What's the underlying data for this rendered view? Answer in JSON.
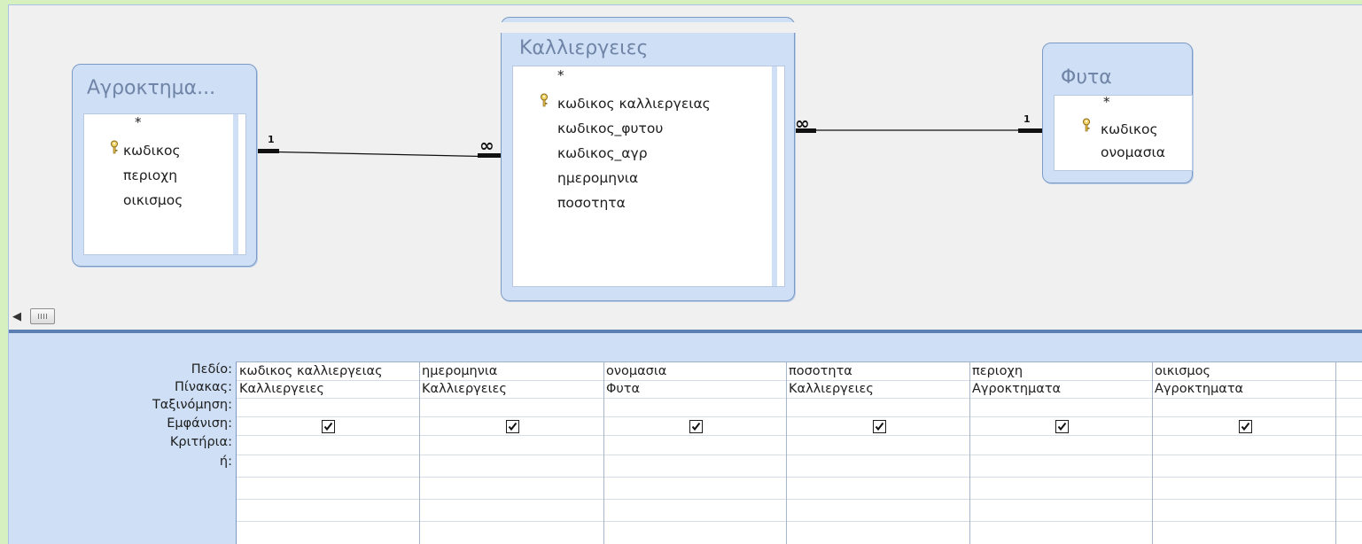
{
  "tables": {
    "agrokt": {
      "title": "Αγροκτημα...",
      "fields": [
        "*",
        "κωδικος",
        "περιοχη",
        "οικισμος"
      ],
      "key_field": "κωδικος"
    },
    "kall": {
      "title": "Καλλιεργειες",
      "fields": [
        "*",
        "κωδικος καλλιεργειας",
        "κωδικος_φυτου",
        "κωδικος_αγρ",
        "ημερομηνια",
        "ποσοτητα"
      ],
      "key_field": "κωδικος καλλιεργειας"
    },
    "fyta": {
      "title": "Φυτα",
      "fields": [
        "*",
        "κωδικος",
        "ονομασια"
      ],
      "key_field": "κωδικος"
    }
  },
  "relationships": [
    {
      "from": "Αγροκτημα...",
      "to": "Καλλιεργειες",
      "from_label": "1",
      "to_label": "∞"
    },
    {
      "from": "Καλλιεργειες",
      "to": "Φυτα",
      "from_label": "∞",
      "to_label": "1"
    }
  ],
  "grid": {
    "row_labels": [
      "Πεδίο:",
      "Πίνακας:",
      "Ταξινόμηση:",
      "Εμφάνιση:",
      "Κριτήρια:",
      "ή:"
    ],
    "columns": [
      {
        "field": "κωδικος καλλιεργειας",
        "table": "Καλλιεργειες",
        "sort": "",
        "show": true
      },
      {
        "field": "ημερομηνια",
        "table": "Καλλιεργειες",
        "sort": "",
        "show": true
      },
      {
        "field": "ονομασια",
        "table": "Φυτα",
        "sort": "",
        "show": true
      },
      {
        "field": "ποσοτητα",
        "table": "Καλλιεργειες",
        "sort": "",
        "show": true
      },
      {
        "field": "περιοχη",
        "table": "Αγροκτηματα",
        "sort": "",
        "show": true
      },
      {
        "field": "οικισμος",
        "table": "Αγροκτηματα",
        "sort": "",
        "show": true
      }
    ]
  },
  "icons": {
    "key": "key-icon",
    "checkbox": "checkmark-icon",
    "scroll_left": "scroll-left-arrow-icon"
  },
  "colors": {
    "table_header": "#cfe0f6",
    "table_border": "#7d9ac4",
    "title_text": "#6f84a6",
    "outer_background": "#d6f0bf"
  }
}
